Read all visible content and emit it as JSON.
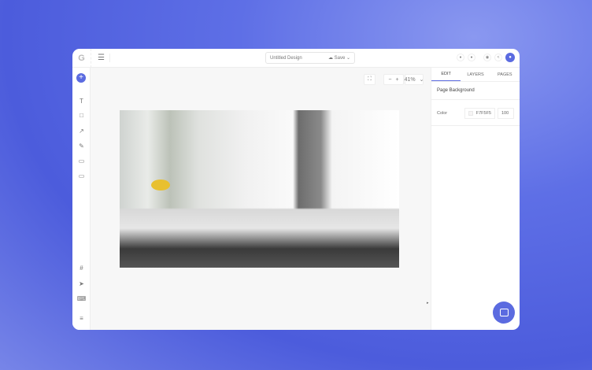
{
  "header": {
    "logo": "G",
    "title": "Untitled Design",
    "save_label": "Save"
  },
  "toolbar": {
    "zoom": "41%",
    "add": "+",
    "zoom_out": "−",
    "zoom_in": "+"
  },
  "panel": {
    "tabs": [
      {
        "label": "EDIT"
      },
      {
        "label": "LAYERS"
      },
      {
        "label": "PAGES"
      }
    ],
    "section": "Page Background",
    "color_label": "Color",
    "color_value": "F7F5F5",
    "opacity": "100"
  },
  "colors": {
    "accent": "#5b6be0"
  }
}
